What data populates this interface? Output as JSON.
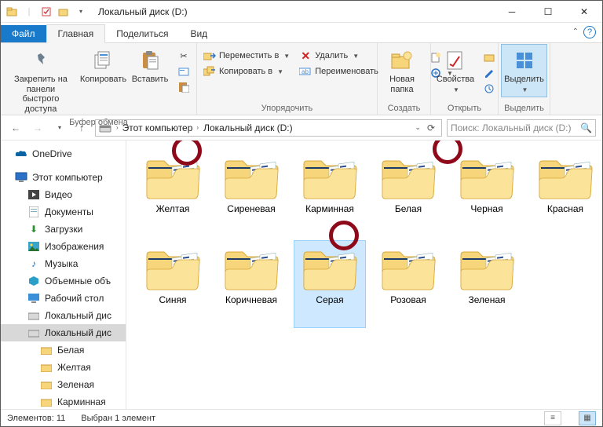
{
  "title": "Локальный диск (D:)",
  "tabs": {
    "file": "Файл",
    "home": "Главная",
    "share": "Поделиться",
    "view": "Вид"
  },
  "ribbon": {
    "pin": "Закрепить на панели\nбыстрого доступа",
    "copy": "Копировать",
    "paste": "Вставить",
    "g1": "Буфер обмена",
    "moveTo": "Переместить в",
    "copyTo": "Копировать в",
    "delete": "Удалить",
    "rename": "Переименовать",
    "g2": "Упорядочить",
    "newFolder": "Новая\nпапка",
    "g3": "Создать",
    "props": "Свойства",
    "g4": "Открыть",
    "select": "Выделить",
    "g5": "Выделить"
  },
  "addr": {
    "thisPC": "Этот компьютер",
    "drive": "Локальный диск (D:)"
  },
  "search": {
    "placeholder": "Поиск: Локальный диск (D:)"
  },
  "nav": {
    "onedrive": "OneDrive",
    "thisPC": "Этот компьютер",
    "videos": "Видео",
    "docs": "Документы",
    "downloads": "Загрузки",
    "pictures": "Изображения",
    "music": "Музыка",
    "objects": "Объемные объ",
    "desktop": "Рабочий стол",
    "cdrive": "Локальный дис",
    "ddrive": "Локальный дис",
    "f1": "Белая",
    "f2": "Желтая",
    "f3": "Зеленая",
    "f4": "Карминная"
  },
  "folders": [
    {
      "name": "Желтая"
    },
    {
      "name": "Сиреневая"
    },
    {
      "name": "Карминная"
    },
    {
      "name": "Белая"
    },
    {
      "name": "Черная"
    },
    {
      "name": "Красная"
    },
    {
      "name": "Синяя"
    },
    {
      "name": "Коричневая"
    },
    {
      "name": "Серая",
      "selected": true
    },
    {
      "name": "Розовая"
    },
    {
      "name": "Зеленая"
    }
  ],
  "status": {
    "count": "Элементов: 11",
    "sel": "Выбран 1 элемент"
  }
}
